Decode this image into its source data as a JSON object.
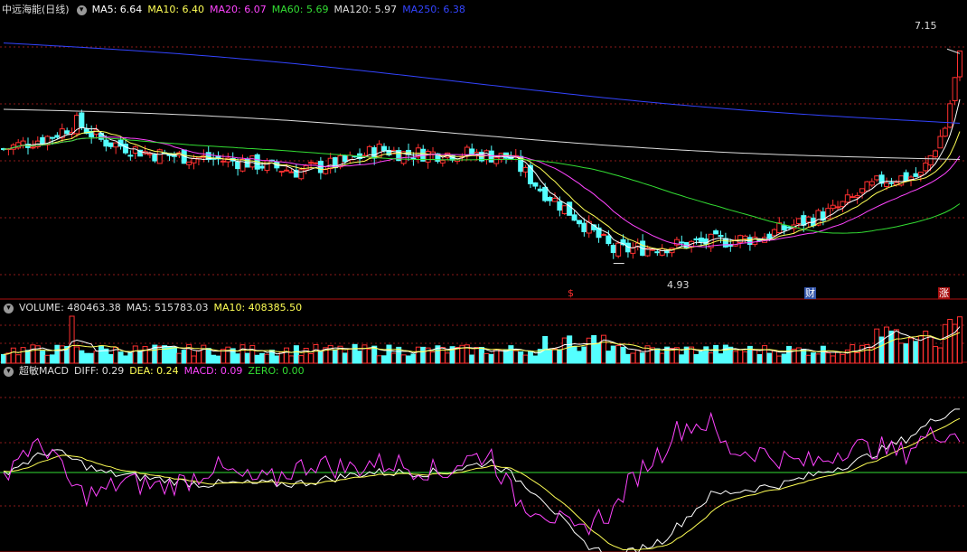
{
  "main": {
    "title": "中远海能(日线)",
    "ma_labels": [
      {
        "text": "MA5: 6.64",
        "color": "#ffffff"
      },
      {
        "text": "MA10: 6.40",
        "color": "#ffff55"
      },
      {
        "text": "MA20: 6.07",
        "color": "#ff44ff"
      },
      {
        "text": "MA60: 5.69",
        "color": "#33dd33"
      },
      {
        "text": "MA120: 5.97",
        "color": "#dddddd"
      },
      {
        "text": "MA250: 6.38",
        "color": "#3344ff"
      }
    ],
    "max_label": "7.15",
    "min_label": "4.93",
    "markers": [
      "$",
      "财",
      "涨"
    ]
  },
  "volume": {
    "labels": [
      {
        "text": "VOLUME: 480463.38",
        "color": "#dddddd"
      },
      {
        "text": "MA5: 515783.03",
        "color": "#dddddd"
      },
      {
        "text": "MA10: 408385.50",
        "color": "#ffff55"
      }
    ]
  },
  "macd": {
    "labels": [
      {
        "text": "超敏MACD",
        "color": "#dddddd"
      },
      {
        "text": "DIFF: 0.29",
        "color": "#dddddd"
      },
      {
        "text": "DEA: 0.24",
        "color": "#ffff55"
      },
      {
        "text": "MACD: 0.09",
        "color": "#ff44ff"
      },
      {
        "text": "ZERO: 0.00",
        "color": "#33dd33"
      }
    ]
  },
  "colors": {
    "up": "#ff3030",
    "down": "#54ffff",
    "grid": "#8b1a1a",
    "zero": "#33dd33"
  },
  "chart_data": [
    {
      "type": "candlestick",
      "title": "中远海能(日线)",
      "ylim": [
        4.7,
        7.5
      ],
      "price_anchors": [
        [
          0,
          6.1
        ],
        [
          10,
          6.25
        ],
        [
          15,
          6.4
        ],
        [
          20,
          6.2
        ],
        [
          30,
          6.05
        ],
        [
          40,
          6.0
        ],
        [
          50,
          5.95
        ],
        [
          60,
          5.85
        ],
        [
          70,
          5.95
        ],
        [
          77,
          6.1
        ],
        [
          82,
          6.05
        ],
        [
          90,
          6.05
        ],
        [
          96,
          6.05
        ],
        [
          104,
          6.0
        ],
        [
          110,
          5.65
        ],
        [
          118,
          5.3
        ],
        [
          122,
          5.1
        ],
        [
          125,
          4.95
        ],
        [
          135,
          5.0
        ],
        [
          145,
          5.05
        ],
        [
          155,
          5.1
        ],
        [
          170,
          5.4
        ],
        [
          180,
          5.75
        ],
        [
          188,
          5.8
        ],
        [
          193,
          6.35
        ],
        [
          196,
          7.15
        ]
      ],
      "max": 7.15,
      "min": 4.93,
      "ma_last": {
        "MA5": 6.64,
        "MA10": 6.4,
        "MA20": 6.07,
        "MA60": 5.69,
        "MA120": 5.97,
        "MA250": 6.38
      }
    },
    {
      "type": "bar",
      "title": "VOLUME",
      "last": 480463.38,
      "MA5": 515783.03,
      "MA10": 408385.5
    },
    {
      "type": "line",
      "title": "超敏MACD",
      "DIFF": 0.29,
      "DEA": 0.24,
      "MACD": 0.09,
      "ZERO": 0.0,
      "diff_anchors": [
        [
          0,
          0.0
        ],
        [
          10,
          0.1
        ],
        [
          15,
          0.05
        ],
        [
          20,
          0.0
        ],
        [
          40,
          -0.05
        ],
        [
          60,
          -0.05
        ],
        [
          75,
          0.0
        ],
        [
          90,
          0.0
        ],
        [
          100,
          0.05
        ],
        [
          110,
          -0.1
        ],
        [
          118,
          -0.3
        ],
        [
          125,
          -0.38
        ],
        [
          135,
          -0.3
        ],
        [
          145,
          -0.1
        ],
        [
          160,
          -0.05
        ],
        [
          175,
          0.05
        ],
        [
          185,
          0.15
        ],
        [
          192,
          0.25
        ],
        [
          196,
          0.29
        ]
      ]
    }
  ]
}
